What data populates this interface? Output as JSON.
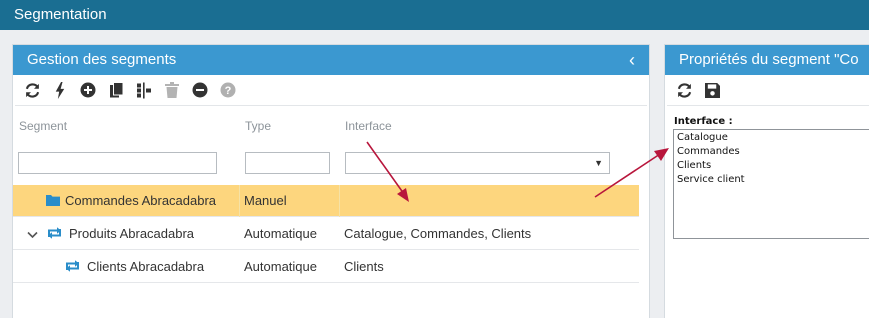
{
  "app": {
    "title": "Segmentation"
  },
  "left_panel": {
    "title": "Gestion des segments",
    "collapse_icon": "chevron-left-icon",
    "toolbar": [
      {
        "icon": "refresh-icon"
      },
      {
        "icon": "lightning-icon"
      },
      {
        "icon": "plus-circle-icon"
      },
      {
        "icon": "copy-icon"
      },
      {
        "icon": "tree-icon"
      },
      {
        "icon": "trash-icon"
      },
      {
        "icon": "minus-circle-icon"
      },
      {
        "icon": "help-icon"
      }
    ],
    "columns": {
      "segment": "Segment",
      "type": "Type",
      "interface": "Interface"
    },
    "filters": {
      "segment": "",
      "type": "",
      "interface_select": ""
    },
    "rows": [
      {
        "name": "Commandes Abracadabra",
        "type": "Manuel",
        "interface": "",
        "icon": "folder-icon",
        "selected": true
      },
      {
        "name": "Produits Abracadabra",
        "type": "Automatique",
        "interface": "Catalogue, Commandes, Clients",
        "icon": "sync-icon",
        "expanded": true
      },
      {
        "name": "Clients Abracadabra",
        "type": "Automatique",
        "interface": "Clients",
        "icon": "sync-icon"
      }
    ]
  },
  "right_panel": {
    "title": "Propriétés du segment \"Co",
    "toolbar": [
      {
        "icon": "refresh-icon"
      },
      {
        "icon": "save-icon"
      }
    ],
    "interface_label": "Interface :",
    "interface_options": [
      "Catalogue",
      "Commandes",
      "Clients",
      "Service client"
    ]
  },
  "colors": {
    "header_bg": "#1a6e92",
    "panel_title_bg": "#3b98d0",
    "selected_row_bg": "#fdd67e",
    "annotation_arrow": "#b8163c",
    "icon_blue": "#2a8dc9"
  }
}
